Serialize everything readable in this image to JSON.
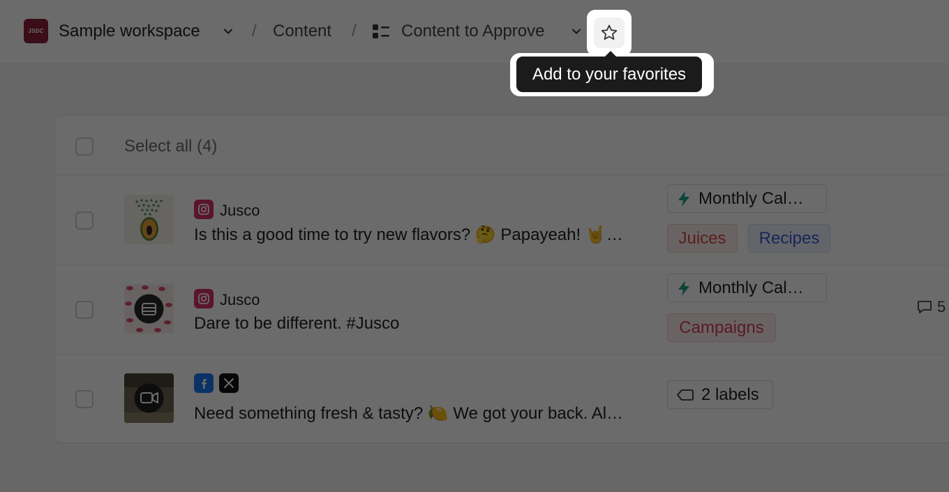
{
  "header": {
    "workspace_logo": "JSDC",
    "workspace_name": "Sample workspace",
    "separator": "/",
    "crumb_content": "Content",
    "crumb_current": "Content to Approve",
    "favorite_tooltip": "Add to your favorites"
  },
  "list": {
    "select_all": "Select all (4)",
    "rows": [
      {
        "networks": [
          "instagram-icon"
        ],
        "author": "Jusco",
        "caption": "Is this a good time to try new flavors? 🤔 Papayeah! 🤘…",
        "campaign": "Monthly Cal…",
        "tags": [
          "Juices",
          "Recipes"
        ],
        "comments": ""
      },
      {
        "networks": [
          "instagram-icon"
        ],
        "author": "Jusco",
        "caption": "Dare to be different. #Jusco",
        "campaign": "Monthly Cal…",
        "tags": [
          "Campaigns"
        ],
        "comments": "5"
      },
      {
        "networks": [
          "facebook-icon",
          "x-icon"
        ],
        "author": "",
        "caption": "Need something fresh & tasty? 🍋 We got your back. Al…",
        "labels": "2 labels",
        "comments": ""
      }
    ]
  },
  "colors": {
    "brand": "#8a1f3c",
    "instagram": "#d6336c",
    "facebook": "#1877f2",
    "tag_red": "#d44a46",
    "tag_blue": "#3a5bd0",
    "tag_pink": "#d6415e",
    "campaign_bolt": "#1fa38a"
  }
}
